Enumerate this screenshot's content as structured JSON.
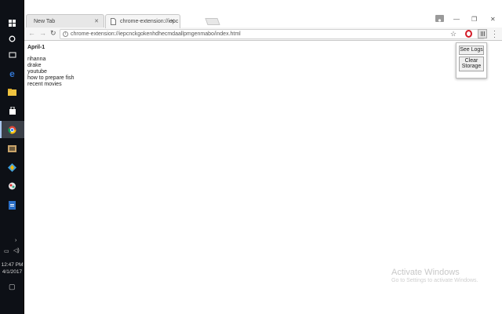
{
  "tabs": [
    {
      "label": "New Tab",
      "active": false
    },
    {
      "label": "chrome-extension://iepc",
      "active": true
    }
  ],
  "address_bar": {
    "url": "chrome-extension://iepcnckgokenhdhecmdaallpmgenmabo/index.html"
  },
  "page": {
    "title": "April-1",
    "items": [
      "rihanna",
      "drake",
      "youtube",
      "how to prepare fish",
      "recent movies"
    ]
  },
  "popup": {
    "see_logs": "See Logs",
    "clear_storage": "Clear Storage"
  },
  "clock": {
    "time": "12:47 PM",
    "date": "4/1/2017"
  },
  "watermark": {
    "title": "Activate Windows",
    "subtitle": "Go to Settings to activate Windows."
  },
  "colors": {
    "taskbar": "#0d1016",
    "opera_red": "#d31b27",
    "edge_blue": "#3277d5"
  }
}
